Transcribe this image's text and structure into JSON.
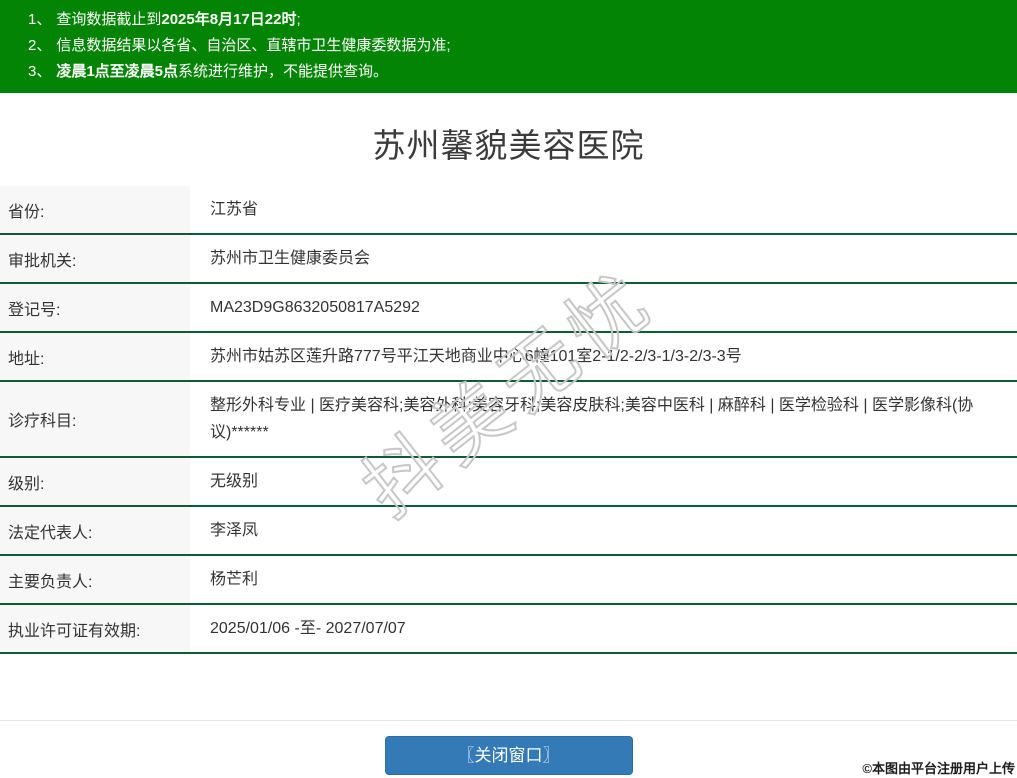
{
  "notice": {
    "items": [
      {
        "num": "1、",
        "segments": [
          {
            "t": "查询数据截止到",
            "b": false
          },
          {
            "t": "2025年8月17日22时",
            "b": true
          },
          {
            "t": ";",
            "b": false
          }
        ]
      },
      {
        "num": "2、",
        "segments": [
          {
            "t": "信息数据结果以各省、自治区、直辖市卫生健康委数据为准;",
            "b": false
          }
        ]
      },
      {
        "num": "3、",
        "segments": [
          {
            "t": "凌晨1点至凌晨5点",
            "b": true
          },
          {
            "t": "系统进行维护，不能提供查询。",
            "b": false
          }
        ]
      }
    ]
  },
  "title": "苏州馨貌美容医院",
  "table": {
    "rows": [
      {
        "label": "省份:",
        "value": "江苏省"
      },
      {
        "label": "审批机关:",
        "value": "苏州市卫生健康委员会"
      },
      {
        "label": "登记号:",
        "value": "MA23D9G8632050817A5292"
      },
      {
        "label": "地址:",
        "value": "苏州市姑苏区莲升路777号平江天地商业中心6幢101室2-1/2-2/3-1/3-2/3-3号"
      },
      {
        "label": "诊疗科目:",
        "value": "整形外科专业 | 医疗美容科;美容外科;美容牙科;美容皮肤科;美容中医科 | 麻醉科 | 医学检验科 | 医学影像科(协议)******"
      },
      {
        "label": "级别:",
        "value": "无级别"
      },
      {
        "label": "法定代表人:",
        "value": "李泽凤"
      },
      {
        "label": "主要负责人:",
        "value": "杨芒利"
      },
      {
        "label": "执业许可证有效期:",
        "value": "2025/01/06 -至- 2027/07/07"
      }
    ]
  },
  "button": {
    "close_label": "〖关闭窗口〗"
  },
  "watermark": {
    "diagonal": "抖美无忧",
    "credit": "©本图由平台注册用户上传"
  },
  "colors": {
    "banner_green": "#048404",
    "divider_green": "#0d5c38",
    "button_blue": "#337ab7",
    "button_border": "#2e6da4",
    "label_bg": "#f7f7f7",
    "text": "#333333",
    "watermark_gray": "#c7c7c7"
  }
}
